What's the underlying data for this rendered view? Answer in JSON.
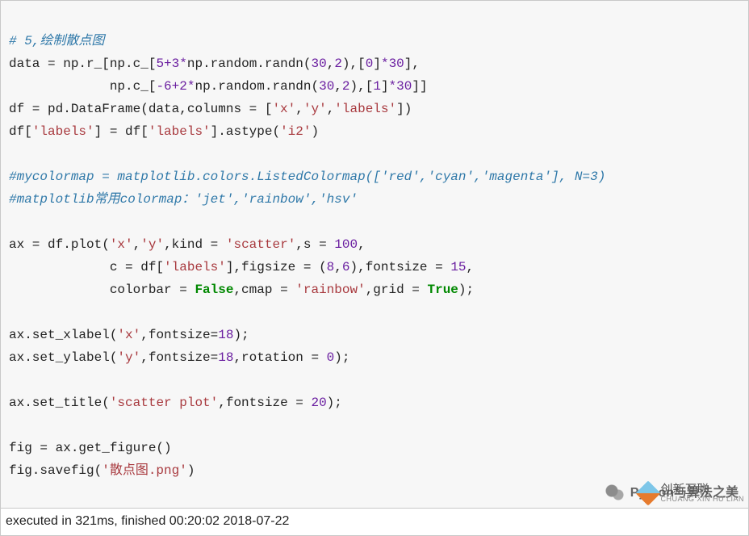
{
  "lines": {
    "l1": "# 5,绘制散点图",
    "l2a": "data = np.r_[np.c_[",
    "l2b": "5",
    "l2c": "+",
    "l2d": "3",
    "l2e": "*",
    "l2f": "np.random.randn(",
    "l2g": "30",
    "l2h": ",",
    "l2i": "2",
    "l2j": "),[",
    "l2k": "0",
    "l2l": "]",
    "l2m": "*",
    "l2n": "30",
    "l2o": "],",
    "l3a": "             np.c_[",
    "l3b": "-6",
    "l3c": "+",
    "l3d": "2",
    "l3e": "*",
    "l3f": "np.random.randn(",
    "l3g": "30",
    "l3h": ",",
    "l3i": "2",
    "l3j": "),[",
    "l3k": "1",
    "l3l": "]",
    "l3m": "*",
    "l3n": "30",
    "l3o": "]]",
    "l4a": "df = pd.DataFrame(data,columns = [",
    "l4b": "'x'",
    "l4c": ",",
    "l4d": "'y'",
    "l4e": ",",
    "l4f": "'labels'",
    "l4g": "])",
    "l5a": "df[",
    "l5b": "'labels'",
    "l5c": "] = df[",
    "l5d": "'labels'",
    "l5e": "].astype(",
    "l5f": "'i2'",
    "l5g": ")",
    "l6": "",
    "l7": "#mycolormap = matplotlib.colors.ListedColormap(['red','cyan','magenta'], N=3)",
    "l8": "#matplotlib常用colormap：'jet','rainbow','hsv'",
    "l9": "",
    "l10a": "ax = df.plot(",
    "l10b": "'x'",
    "l10c": ",",
    "l10d": "'y'",
    "l10e": ",kind = ",
    "l10f": "'scatter'",
    "l10g": ",s = ",
    "l10h": "100",
    "l10i": ",",
    "l11a": "             c = df[",
    "l11b": "'labels'",
    "l11c": "],figsize = (",
    "l11d": "8",
    "l11e": ",",
    "l11f": "6",
    "l11g": "),fontsize = ",
    "l11h": "15",
    "l11i": ",",
    "l12a": "             colorbar = ",
    "l12b": "False",
    "l12c": ",cmap = ",
    "l12d": "'rainbow'",
    "l12e": ",grid = ",
    "l12f": "True",
    "l12g": ");",
    "l13": "",
    "l14a": "ax.set_xlabel(",
    "l14b": "'x'",
    "l14c": ",fontsize=",
    "l14d": "18",
    "l14e": ");",
    "l15a": "ax.set_ylabel(",
    "l15b": "'y'",
    "l15c": ",fontsize=",
    "l15d": "18",
    "l15e": ",rotation = ",
    "l15f": "0",
    "l15g": ");",
    "l16": "",
    "l17a": "ax.set_title(",
    "l17b": "'scatter plot'",
    "l17c": ",fontsize = ",
    "l17d": "20",
    "l17e": ");",
    "l18": "",
    "l19": "fig = ax.get_figure()",
    "l20a": "fig.savefig(",
    "l20b": "'散点图.png'",
    "l20c": ")"
  },
  "status": "executed in 321ms, finished 00:20:02 2018-07-22",
  "watermark": {
    "wechat_label": "Python与算法之美",
    "brand_cn": "创新互联",
    "brand_en": "CHUANG XIN HU LIAN"
  }
}
